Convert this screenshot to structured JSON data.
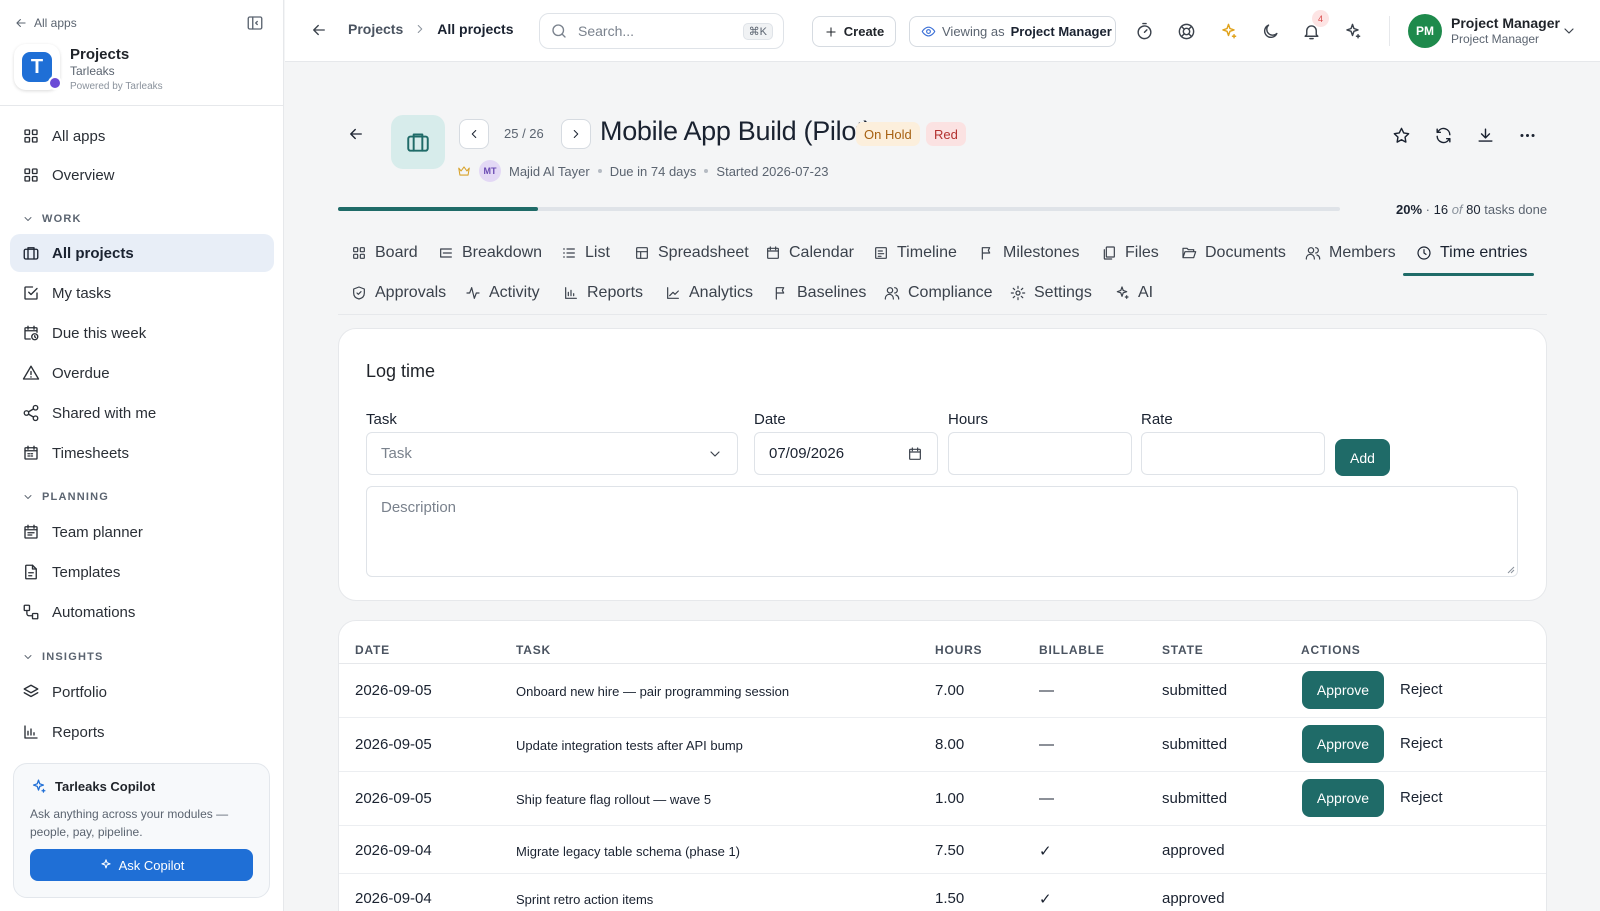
{
  "sidebar": {
    "back_label": "All apps",
    "app_name": "Projects",
    "org": "Tarleaks",
    "powered": "Powered by Tarleaks",
    "logo_letter": "T",
    "nav": {
      "all_apps": "All apps",
      "overview": "Overview",
      "all_projects": "All projects",
      "my_tasks": "My tasks",
      "due_week": "Due this week",
      "overdue": "Overdue",
      "shared": "Shared with me",
      "timesheets": "Timesheets",
      "team_planner": "Team planner",
      "templates": "Templates",
      "automations": "Automations",
      "portfolio": "Portfolio",
      "reports": "Reports"
    },
    "sections": {
      "work": "WORK",
      "planning": "PLANNING",
      "insights": "INSIGHTS"
    },
    "copilot": {
      "title": "Tarleaks Copilot",
      "desc": "Ask anything across your modules — people, pay, pipeline.",
      "button": "Ask Copilot"
    }
  },
  "topbar": {
    "crumb_parent": "Projects",
    "crumb_current": "All projects",
    "search_placeholder": "Search...",
    "search_kbd": "⌘K",
    "create_label": "Create",
    "viewing_label": "Viewing as",
    "viewing_value": "Project Manager",
    "notification_count": "4",
    "avatar_initials": "PM",
    "user_name": "Project Manager",
    "user_role": "Project Manager"
  },
  "project": {
    "pager": "25 / 26",
    "title": "Mobile App Build (Pilot)",
    "status": "On Hold",
    "health": "Red",
    "owner_initials": "MT",
    "owner": "Majid Al Tayer",
    "due": "Due in 74 days",
    "started": "Started 2026-07-23",
    "progress_fraction": 0.2,
    "progress_pct": "20%",
    "tasks_done": "16",
    "tasks_of": "of",
    "tasks_total": "80",
    "tasks_suffix": "tasks done"
  },
  "tabs": {
    "row1": [
      "Board",
      "Breakdown",
      "List",
      "Spreadsheet",
      "Calendar",
      "Timeline",
      "Milestones",
      "Files",
      "Documents",
      "Members",
      "Time entries"
    ],
    "row2": [
      "Approvals",
      "Activity",
      "Reports",
      "Analytics",
      "Baselines",
      "Compliance",
      "Settings",
      "AI"
    ],
    "active": "Time entries"
  },
  "log_time": {
    "title": "Log time",
    "task_label": "Task",
    "task_placeholder": "Task",
    "date_label": "Date",
    "date_value": "07/09/2026",
    "hours_label": "Hours",
    "rate_label": "Rate",
    "add_label": "Add",
    "description_placeholder": "Description"
  },
  "entries": {
    "headers": {
      "date": "DATE",
      "task": "TASK",
      "hours": "HOURS",
      "billable": "BILLABLE",
      "state": "STATE",
      "actions": "ACTIONS"
    },
    "approve_label": "Approve",
    "reject_label": "Reject",
    "rows": [
      {
        "date": "2026-09-05",
        "task": "Onboard new hire — pair programming session",
        "hours": "7.00",
        "billable": "—",
        "state": "submitted"
      },
      {
        "date": "2026-09-05",
        "task": "Update integration tests after API bump",
        "hours": "8.00",
        "billable": "—",
        "state": "submitted"
      },
      {
        "date": "2026-09-05",
        "task": "Ship feature flag rollout — wave 5",
        "hours": "1.00",
        "billable": "—",
        "state": "submitted"
      },
      {
        "date": "2026-09-04",
        "task": "Migrate legacy table schema (phase 1)",
        "hours": "7.50",
        "billable": "✓",
        "state": "approved"
      },
      {
        "date": "2026-09-04",
        "task": "Sprint retro action items",
        "hours": "1.50",
        "billable": "✓",
        "state": "approved"
      }
    ]
  }
}
